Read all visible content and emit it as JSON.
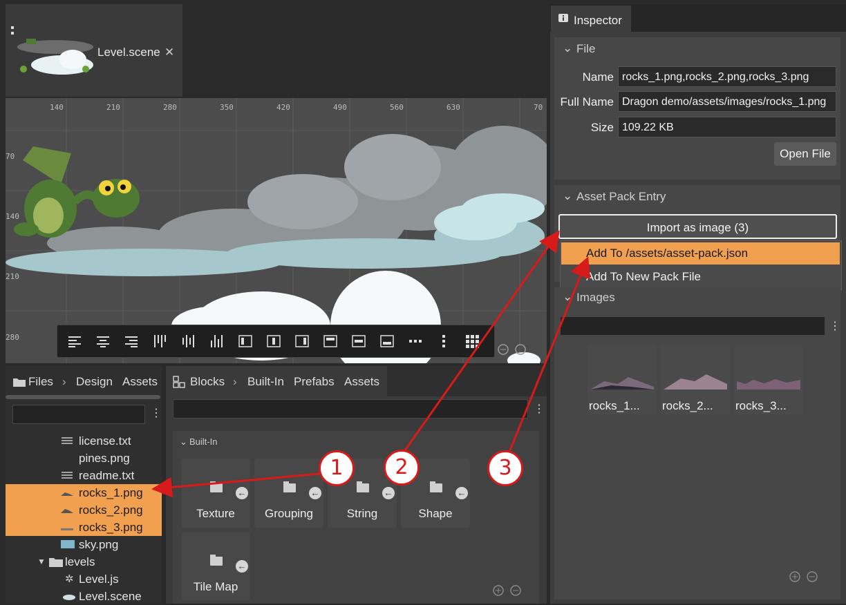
{
  "editor": {
    "tab_title": "Level.scene",
    "close_glyph": "✕"
  },
  "ruler": {
    "x_labels": [
      "140",
      "210",
      "280",
      "350",
      "420",
      "490",
      "560",
      "630",
      "70"
    ],
    "y_labels": [
      "70",
      "140",
      "210",
      "280"
    ]
  },
  "toolbar": {
    "tools": [
      "align-left-icon",
      "align-center-icon",
      "align-right-icon",
      "distribute-left-icon",
      "distribute-center-icon",
      "distribute-right-icon",
      "align-border-left-icon",
      "align-border-center-icon",
      "align-border-right-icon",
      "align-top-icon",
      "align-middle-icon",
      "align-bottom-icon",
      "more-horizontal-icon",
      "more-vertical-icon",
      "grid-icon"
    ]
  },
  "files": {
    "breadcrumb": [
      "Files",
      "Design",
      "Assets"
    ],
    "rows": [
      {
        "label": "license.txt",
        "icon": "text-file-icon",
        "selected": false
      },
      {
        "label": "pines.png",
        "icon": "",
        "selected": false
      },
      {
        "label": "readme.txt",
        "icon": "text-file-icon",
        "selected": false
      },
      {
        "label": "rocks_1.png",
        "icon": "image-icon",
        "selected": true
      },
      {
        "label": "rocks_2.png",
        "icon": "image-icon",
        "selected": true
      },
      {
        "label": "rocks_3.png",
        "icon": "image-icon",
        "selected": true
      },
      {
        "label": "sky.png",
        "icon": "image-icon",
        "selected": false
      },
      {
        "label": "levels",
        "icon": "folder-icon",
        "selected": false
      },
      {
        "label": "Level.js",
        "icon": "script-icon",
        "selected": false
      },
      {
        "label": "Level.scene",
        "icon": "scene-icon",
        "selected": false
      }
    ]
  },
  "blocks": {
    "breadcrumb": [
      "Blocks",
      "Built-In",
      "Prefabs",
      "Assets"
    ],
    "section": "Built-In",
    "items": [
      "Texture",
      "Grouping",
      "String",
      "Shape",
      "Tile Map"
    ]
  },
  "inspector": {
    "tab": "Inspector",
    "file_section": "File",
    "name_label": "Name",
    "name_value": "rocks_1.png,rocks_2.png,rocks_3.png",
    "fullname_label": "Full Name",
    "fullname_value": "Dragon demo/assets/images/rocks_1.png",
    "size_label": "Size",
    "size_value": "109.22 KB",
    "open_file": "Open File",
    "asset_section": "Asset Pack Entry",
    "import_button": "Import as image (3)",
    "menu_items": [
      "Add To /assets/asset-pack.json",
      "Add To New Pack File"
    ],
    "images_section": "Images",
    "thumbs": [
      "rocks_1...",
      "rocks_2...",
      "rocks_3..."
    ]
  },
  "callouts": [
    "1",
    "2",
    "3"
  ],
  "colors": {
    "selection": "#f0a04f",
    "callout": "#d71a1a",
    "dragon": "#4f7a33"
  }
}
